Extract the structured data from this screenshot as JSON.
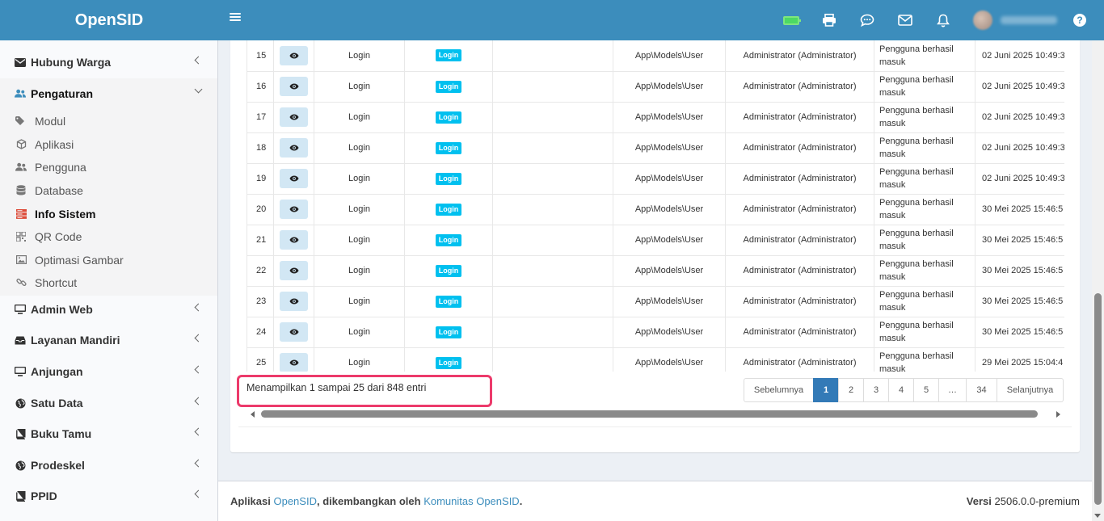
{
  "app": {
    "brand": "OpenSID"
  },
  "sidebar": {
    "items": [
      {
        "label": "Hubung Warga",
        "icon": "envelope-icon"
      },
      {
        "label": "Pengaturan",
        "icon": "users-icon"
      },
      {
        "label": "Admin Web",
        "icon": "desktop-icon"
      },
      {
        "label": "Layanan Mandiri",
        "icon": "inbox-icon"
      },
      {
        "label": "Anjungan",
        "icon": "monitor-icon"
      },
      {
        "label": "Satu Data",
        "icon": "globe-icon"
      },
      {
        "label": "Buku Tamu",
        "icon": "book-icon"
      },
      {
        "label": "Prodeskel",
        "icon": "globe-icon"
      },
      {
        "label": "PPID",
        "icon": "book-icon"
      }
    ],
    "submenu": [
      {
        "label": "Modul",
        "icon": "tags-icon"
      },
      {
        "label": "Aplikasi",
        "icon": "cube-icon"
      },
      {
        "label": "Pengguna",
        "icon": "users-icon"
      },
      {
        "label": "Database",
        "icon": "database-icon"
      },
      {
        "label": "Info Sistem",
        "icon": "server-icon",
        "active": true
      },
      {
        "label": "QR Code",
        "icon": "qrcode-icon"
      },
      {
        "label": "Optimasi Gambar",
        "icon": "image-icon"
      },
      {
        "label": "Shortcut",
        "icon": "link-icon"
      }
    ]
  },
  "table": {
    "rows": [
      {
        "no": "15",
        "event": "Login",
        "label": "Login",
        "model": "App\\Models\\User",
        "user": "Administrator (Administrator)",
        "desc": "Pengguna berhasil masuk",
        "date": "02 Juni 2025 10:49:3"
      },
      {
        "no": "16",
        "event": "Login",
        "label": "Login",
        "model": "App\\Models\\User",
        "user": "Administrator (Administrator)",
        "desc": "Pengguna berhasil masuk",
        "date": "02 Juni 2025 10:49:3"
      },
      {
        "no": "17",
        "event": "Login",
        "label": "Login",
        "model": "App\\Models\\User",
        "user": "Administrator (Administrator)",
        "desc": "Pengguna berhasil masuk",
        "date": "02 Juni 2025 10:49:3"
      },
      {
        "no": "18",
        "event": "Login",
        "label": "Login",
        "model": "App\\Models\\User",
        "user": "Administrator (Administrator)",
        "desc": "Pengguna berhasil masuk",
        "date": "02 Juni 2025 10:49:3"
      },
      {
        "no": "19",
        "event": "Login",
        "label": "Login",
        "model": "App\\Models\\User",
        "user": "Administrator (Administrator)",
        "desc": "Pengguna berhasil masuk",
        "date": "02 Juni 2025 10:49:3"
      },
      {
        "no": "20",
        "event": "Login",
        "label": "Login",
        "model": "App\\Models\\User",
        "user": "Administrator (Administrator)",
        "desc": "Pengguna berhasil masuk",
        "date": "30 Mei 2025 15:46:5"
      },
      {
        "no": "21",
        "event": "Login",
        "label": "Login",
        "model": "App\\Models\\User",
        "user": "Administrator (Administrator)",
        "desc": "Pengguna berhasil masuk",
        "date": "30 Mei 2025 15:46:5"
      },
      {
        "no": "22",
        "event": "Login",
        "label": "Login",
        "model": "App\\Models\\User",
        "user": "Administrator (Administrator)",
        "desc": "Pengguna berhasil masuk",
        "date": "30 Mei 2025 15:46:5"
      },
      {
        "no": "23",
        "event": "Login",
        "label": "Login",
        "model": "App\\Models\\User",
        "user": "Administrator (Administrator)",
        "desc": "Pengguna berhasil masuk",
        "date": "30 Mei 2025 15:46:5"
      },
      {
        "no": "24",
        "event": "Login",
        "label": "Login",
        "model": "App\\Models\\User",
        "user": "Administrator (Administrator)",
        "desc": "Pengguna berhasil masuk",
        "date": "30 Mei 2025 15:46:5"
      },
      {
        "no": "25",
        "event": "Login",
        "label": "Login",
        "model": "App\\Models\\User",
        "user": "Administrator (Administrator)",
        "desc": "Pengguna berhasil masuk",
        "date": "29 Mei 2025 15:04:4"
      }
    ]
  },
  "info": {
    "text": "Menampilkan 1 sampai 25 dari 848 entri"
  },
  "pagination": {
    "prev": "Sebelumnya",
    "pages": [
      "1",
      "2",
      "3",
      "4",
      "5",
      "…",
      "34"
    ],
    "active": "1",
    "next": "Selanjutnya"
  },
  "footer": {
    "prefix": "Aplikasi",
    "app_link": "OpenSID",
    "middle": ", dikembangkan oleh",
    "community_link": "Komunitas OpenSID",
    "suffix": ".",
    "version_label": "Versi",
    "version": "2506.0.0-premium"
  },
  "colors": {
    "header": "#3c8dbc",
    "label_info": "#00c0ef",
    "highlight": "#ec3a6b",
    "active_page": "#337ab7"
  }
}
